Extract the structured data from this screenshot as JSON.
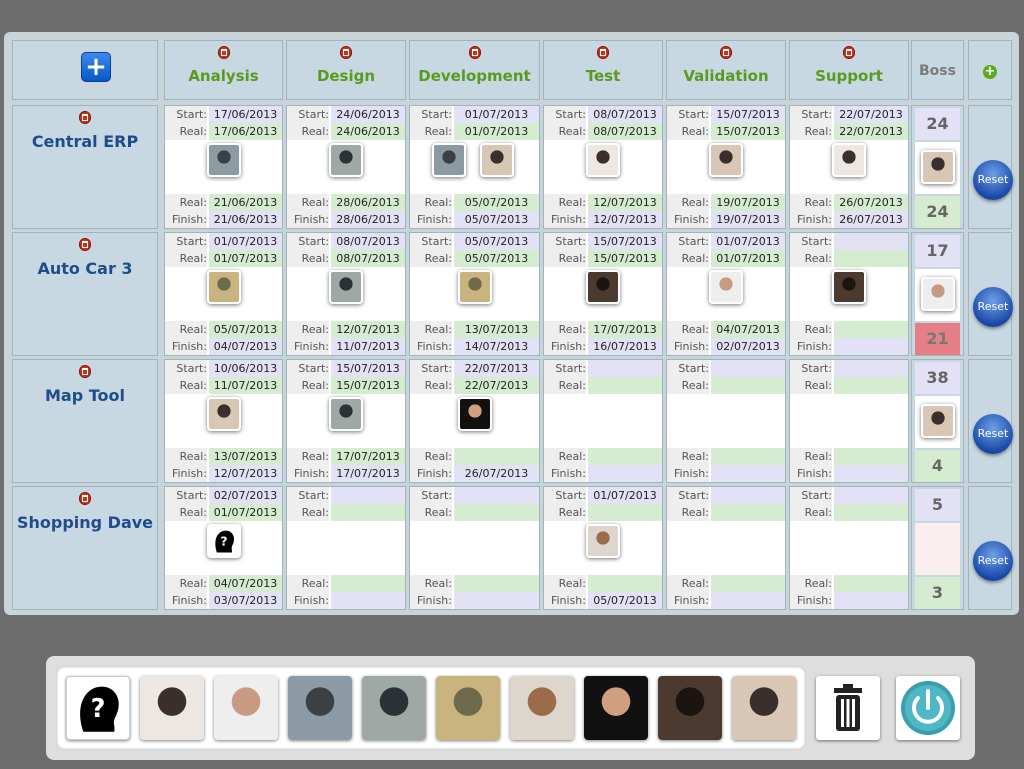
{
  "phases": [
    {
      "name": "Analysis"
    },
    {
      "name": "Design"
    },
    {
      "name": "Development"
    },
    {
      "name": "Test"
    },
    {
      "name": "Validation"
    },
    {
      "name": "Support"
    }
  ],
  "boss_label": "Boss",
  "add_project_label": "+",
  "add_phase_label": "+",
  "reset_label": "Reset",
  "labels": {
    "start": "Start:",
    "real": "Real:",
    "finish": "Finish:"
  },
  "projects": [
    {
      "name": "Central ERP",
      "boss": {
        "planned": "24",
        "actual": "24",
        "actual_status": "ok",
        "avatar": "person-4"
      },
      "phases": [
        {
          "start": "17/06/2013",
          "real_start": "17/06/2013",
          "real_finish": "21/06/2013",
          "finish": "21/06/2013",
          "avatars": [
            "person-1"
          ]
        },
        {
          "start": "24/06/2013",
          "real_start": "24/06/2013",
          "real_finish": "28/06/2013",
          "finish": "28/06/2013",
          "avatars": [
            "person-2"
          ]
        },
        {
          "start": "01/07/2013",
          "real_start": "01/07/2013",
          "real_finish": "05/07/2013",
          "finish": "05/07/2013",
          "avatars": [
            "person-1",
            "person-4"
          ]
        },
        {
          "start": "08/07/2013",
          "real_start": "08/07/2013",
          "real_finish": "12/07/2013",
          "finish": "12/07/2013",
          "avatars": [
            "person-5"
          ]
        },
        {
          "start": "15/07/2013",
          "real_start": "15/07/2013",
          "real_finish": "19/07/2013",
          "finish": "19/07/2013",
          "avatars": [
            "person-4"
          ]
        },
        {
          "start": "22/07/2013",
          "real_start": "22/07/2013",
          "real_finish": "26/07/2013",
          "finish": "26/07/2013",
          "avatars": [
            "person-5"
          ]
        }
      ]
    },
    {
      "name": "Auto Car 3",
      "boss": {
        "planned": "17",
        "actual": "21",
        "actual_status": "bad",
        "avatar": "person-6"
      },
      "phases": [
        {
          "start": "01/07/2013",
          "real_start": "01/07/2013",
          "real_finish": "05/07/2013",
          "finish": "04/07/2013",
          "avatars": [
            "person-3"
          ]
        },
        {
          "start": "08/07/2013",
          "real_start": "08/07/2013",
          "real_finish": "12/07/2013",
          "finish": "11/07/2013",
          "avatars": [
            "person-2"
          ]
        },
        {
          "start": "05/07/2013",
          "real_start": "05/07/2013",
          "real_finish": "13/07/2013",
          "finish": "14/07/2013",
          "avatars": [
            "person-3"
          ]
        },
        {
          "start": "15/07/2013",
          "real_start": "15/07/2013",
          "real_finish": "17/07/2013",
          "finish": "16/07/2013",
          "avatars": [
            "person-7"
          ]
        },
        {
          "start": "01/07/2013",
          "real_start": "01/07/2013",
          "real_finish": "04/07/2013",
          "finish": "02/07/2013",
          "avatars": [
            "person-6"
          ]
        },
        {
          "start": "",
          "real_start": "",
          "real_finish": "",
          "finish": "",
          "avatars": [
            "person-7"
          ]
        }
      ]
    },
    {
      "name": "Map Tool",
      "boss": {
        "planned": "38",
        "actual": "4",
        "actual_status": "ok",
        "avatar": "person-4"
      },
      "phases": [
        {
          "start": "10/06/2013",
          "real_start": "11/07/2013",
          "real_finish": "13/07/2013",
          "finish": "12/07/2013",
          "avatars": [
            "person-4"
          ]
        },
        {
          "start": "15/07/2013",
          "real_start": "15/07/2013",
          "real_finish": "17/07/2013",
          "finish": "17/07/2013",
          "avatars": [
            "person-2"
          ]
        },
        {
          "start": "22/07/2013",
          "real_start": "22/07/2013",
          "real_finish": "",
          "finish": "26/07/2013",
          "avatars": [
            "person-8"
          ]
        },
        {
          "start": "",
          "real_start": "",
          "real_finish": "",
          "finish": "",
          "avatars": []
        },
        {
          "start": "",
          "real_start": "",
          "real_finish": "",
          "finish": "",
          "avatars": []
        },
        {
          "start": "",
          "real_start": "",
          "real_finish": "",
          "finish": "",
          "avatars": []
        }
      ]
    },
    {
      "name": "Shopping Dave",
      "boss": {
        "planned": "5",
        "actual": "3",
        "actual_status": "ok",
        "avatar": ""
      },
      "phases": [
        {
          "start": "02/07/2013",
          "real_start": "01/07/2013",
          "real_finish": "04/07/2013",
          "finish": "03/07/2013",
          "avatars": [
            "unknown"
          ]
        },
        {
          "start": "",
          "real_start": "",
          "real_finish": "",
          "finish": "",
          "avatars": []
        },
        {
          "start": "",
          "real_start": "",
          "real_finish": "",
          "finish": "",
          "avatars": []
        },
        {
          "start": "01/07/2013",
          "real_start": "",
          "real_finish": "",
          "finish": "05/07/2013",
          "avatars": [
            "person-9"
          ]
        },
        {
          "start": "",
          "real_start": "",
          "real_finish": "",
          "finish": "",
          "avatars": []
        },
        {
          "start": "",
          "real_start": "",
          "real_finish": "",
          "finish": "",
          "avatars": []
        }
      ]
    }
  ],
  "people": [
    {
      "id": "unknown",
      "icon": "unknown-person-icon"
    },
    {
      "id": "person-5"
    },
    {
      "id": "person-6"
    },
    {
      "id": "person-1"
    },
    {
      "id": "person-2"
    },
    {
      "id": "person-3"
    },
    {
      "id": "person-9"
    },
    {
      "id": "person-8"
    },
    {
      "id": "person-7"
    },
    {
      "id": "person-4"
    }
  ],
  "avatar_colors": {
    "person-1": [
      "#8c9aa3",
      "#3c3f44"
    ],
    "person-2": [
      "#9fa8a5",
      "#2c3136"
    ],
    "person-3": [
      "#c9b47f",
      "#6e6a4e"
    ],
    "person-4": [
      "#d8c7b5",
      "#3a2f2c"
    ],
    "person-5": [
      "#ece7e2",
      "#3a2f2a"
    ],
    "person-6": [
      "#eeeeee",
      "#c89a84"
    ],
    "person-7": [
      "#4c3a30",
      "#1c1410"
    ],
    "person-8": [
      "#111111",
      "#d0a07e"
    ],
    "person-9": [
      "#dcd6cc",
      "#9b6b4a"
    ]
  },
  "tray_icons": {
    "trash": "trash-icon",
    "power": "power-icon"
  }
}
